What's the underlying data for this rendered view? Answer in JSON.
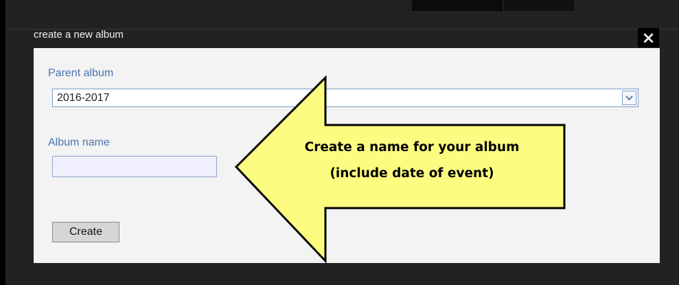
{
  "dialog": {
    "title": "create a new album",
    "close_icon": "×"
  },
  "form": {
    "parent_album_label": "Parent album",
    "parent_album_selected": "2016-2017",
    "album_name_label": "Album name",
    "album_name_value": "",
    "create_label": "Create"
  },
  "callout": {
    "line1": "Create a name for your album",
    "line2": "(include date of event)",
    "fill_color": "#fcfc80"
  }
}
